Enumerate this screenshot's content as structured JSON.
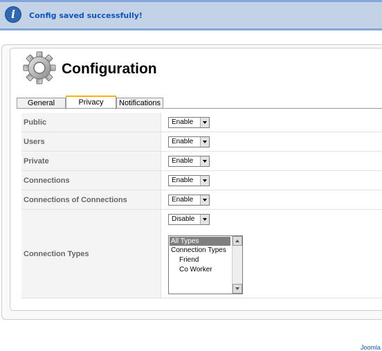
{
  "message": {
    "text": "Config saved successfully!",
    "icon": "info-icon",
    "color": "#0b55c4"
  },
  "header": {
    "title": "Configuration",
    "icon": "gear-icon"
  },
  "tabs": [
    {
      "label": "General",
      "active": false
    },
    {
      "label": "Privacy",
      "active": true
    },
    {
      "label": "Notifications",
      "active": false
    }
  ],
  "settings": [
    {
      "label": "Public",
      "value": "Enable"
    },
    {
      "label": "Users",
      "value": "Enable"
    },
    {
      "label": "Private",
      "value": "Enable"
    },
    {
      "label": "Connections",
      "value": "Enable"
    },
    {
      "label": "Connections of Connections",
      "value": "Enable"
    },
    {
      "label": "Connection Types",
      "value": "Disable"
    }
  ],
  "connection_types_list": {
    "options": [
      "All Types",
      "Connection Types",
      "Friend",
      "Co Worker"
    ],
    "selected": "All Types"
  },
  "footer": {
    "link_text": "Joomla"
  },
  "colors": {
    "accent_tab": "#ffb000",
    "message_bg": "#c3d2e5",
    "message_border": "#84a7db"
  }
}
